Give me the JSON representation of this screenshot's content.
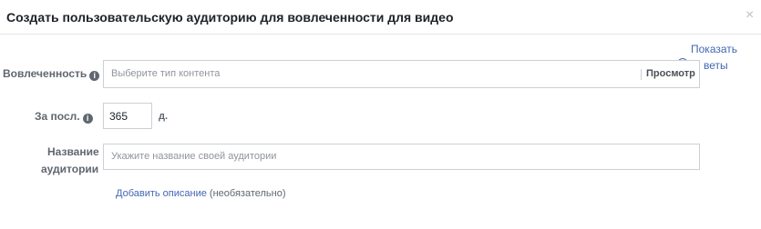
{
  "dialog": {
    "title": "Создать пользовательскую аудиторию для вовлеченности для видео",
    "close_glyph": "×"
  },
  "tips": {
    "line1": "Показать",
    "line2": "веты",
    "icon": "chevron-left-circle-icon"
  },
  "engagement": {
    "label": "Вовлеченность",
    "placeholder": "Выберите тип контента",
    "preview_label": "Просмотр"
  },
  "period": {
    "label": "За посл.",
    "value": "365",
    "unit": "д."
  },
  "audience_name": {
    "label_line1": "Название",
    "label_line2": "аудитории",
    "placeholder": "Укажите название своей аудитории"
  },
  "description": {
    "link_text": "Добавить описание",
    "optional_text": "(необязательно)"
  },
  "colors": {
    "link": "#4267b2",
    "label": "#606770",
    "border": "#ccd0d5"
  }
}
